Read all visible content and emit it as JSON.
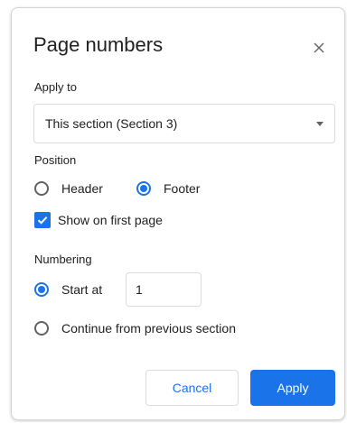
{
  "dialog": {
    "title": "Page numbers",
    "apply_to": {
      "label": "Apply to",
      "selected": "This section (Section 3)"
    },
    "position": {
      "label": "Position",
      "options": [
        {
          "label": "Header",
          "checked": false
        },
        {
          "label": "Footer",
          "checked": true
        }
      ],
      "show_first_page": {
        "label": "Show on first page",
        "checked": true
      }
    },
    "numbering": {
      "label": "Numbering",
      "start_at_label": "Start at",
      "start_at_value": "1",
      "start_at_checked": true,
      "continue_label": "Continue from previous section",
      "continue_checked": false
    },
    "buttons": {
      "cancel": "Cancel",
      "apply": "Apply"
    }
  },
  "colors": {
    "accent": "#1a73e8",
    "border": "#dadce0",
    "text": "#202124",
    "icon": "#5f6368"
  },
  "icons": {
    "close": "close-icon",
    "dropdown": "chevron-down-icon",
    "check": "check-icon"
  }
}
